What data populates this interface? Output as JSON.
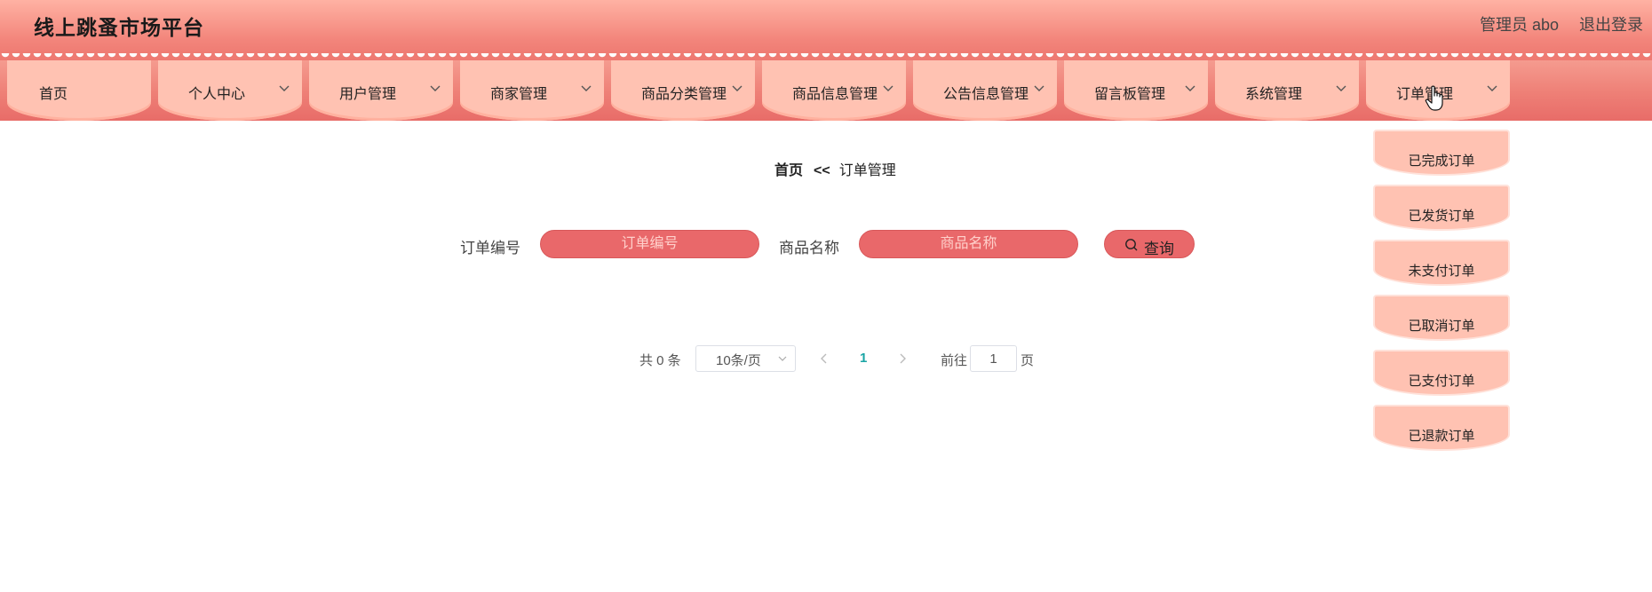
{
  "header": {
    "title": "线上跳蚤市场平台",
    "user_label": "管理员 abo",
    "logout_label": "退出登录"
  },
  "nav": {
    "items": [
      {
        "label": "首页",
        "has_dropdown": false
      },
      {
        "label": "个人中心",
        "has_dropdown": true
      },
      {
        "label": "用户管理",
        "has_dropdown": true
      },
      {
        "label": "商家管理",
        "has_dropdown": true
      },
      {
        "label": "商品分类管理",
        "has_dropdown": true
      },
      {
        "label": "商品信息管理",
        "has_dropdown": true
      },
      {
        "label": "公告信息管理",
        "has_dropdown": true
      },
      {
        "label": "留言板管理",
        "has_dropdown": true
      },
      {
        "label": "系统管理",
        "has_dropdown": true
      },
      {
        "label": "订单管理",
        "has_dropdown": true
      }
    ],
    "dropdown": {
      "parent": "订单管理",
      "items": [
        "已完成订单",
        "已发货订单",
        "未支付订单",
        "已取消订单",
        "已支付订单",
        "已退款订单"
      ]
    }
  },
  "breadcrumb": {
    "home": "首页",
    "separator": "<<",
    "current": "订单管理"
  },
  "search": {
    "order_no_label": "订单编号",
    "order_no_placeholder": "订单编号",
    "product_name_label": "商品名称",
    "product_name_placeholder": "商品名称",
    "query_label": "查询"
  },
  "pagination": {
    "total_text": "共 0 条",
    "page_size": "10条/页",
    "current_page": "1",
    "goto_label": "前往",
    "goto_value": "1",
    "page_unit": "页"
  },
  "colors": {
    "header_top": "#ffb2a3",
    "header_bottom": "#ee7a72",
    "nav_tab": "#ffc2b2",
    "input_fill": "#e9686a",
    "active_page": "#1aa5a5"
  }
}
